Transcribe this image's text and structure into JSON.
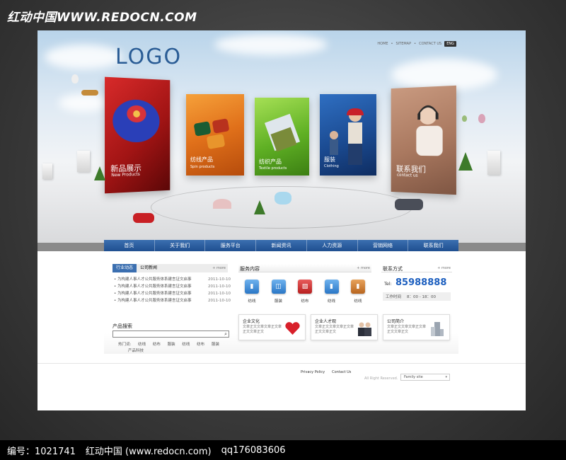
{
  "watermark": {
    "top": "红动中国WWW.REDOCN.COM",
    "bottom_id": "编号：1021741",
    "bottom_site": "红动中国 (www.redocn.com)",
    "bottom_qq": "qq176083606"
  },
  "header": {
    "logo": "LOGO",
    "links": [
      "HOME",
      "SITEMAP",
      "CONTACT US"
    ],
    "separator": "•",
    "lang": "ENG"
  },
  "hero": {
    "panels": [
      {
        "cn": "新品展示",
        "en": "New Products"
      },
      {
        "cn": "纺线产品",
        "en": "Spin products"
      },
      {
        "cn": "纺织产品",
        "en": "Textile products"
      },
      {
        "cn": "服装",
        "en": "Clothing"
      },
      {
        "cn": "联系我们",
        "en": "contact us"
      }
    ]
  },
  "nav": [
    "首页",
    "关于我们",
    "服务平台",
    "新闻资讯",
    "人力资源",
    "营销网络",
    "联系我们"
  ],
  "news": {
    "tab_active": "行业动态",
    "tab_other": "公司新闻",
    "more": "+ more",
    "items": [
      {
        "title": "• 为构建人事人才公共服务体系建言证文启事",
        "date": "2011-10-10"
      },
      {
        "title": "• 为构建人事人才公共服务体系建言证文启事",
        "date": "2011-10-10"
      },
      {
        "title": "• 为构建人事人才公共服务体系建言证文启事",
        "date": "2011-10-10"
      },
      {
        "title": "• 为构建人事人才公共服务体系建言证文启事",
        "date": "2011-10-10"
      }
    ]
  },
  "product_search": {
    "title": "产品搜索",
    "hot_label": "热门词:",
    "hot_words": [
      "纺线",
      "纺布",
      "服装",
      "纺线",
      "纺布",
      "服装",
      "产品科技"
    ]
  },
  "services": {
    "title": "服务内容",
    "more": "+ more",
    "items": [
      "纺线",
      "服装",
      "纺布",
      "纺线",
      "纺线"
    ]
  },
  "contact": {
    "title": "联系方式",
    "more": "+ more",
    "tel_label": "Tel:",
    "tel": "85988888",
    "hours_label": "工作时间",
    "hours": "8：00 - 18：00"
  },
  "cards": [
    {
      "title": "企业文化",
      "body": "文章正文文章文章正文章正文文章正文"
    },
    {
      "title": "企业人才观",
      "body": "文章正文文章文章正文章正文文章正文"
    },
    {
      "title": "公司简介",
      "body": "文章正文文章文章正文章正文文章正文"
    }
  ],
  "footer": {
    "privacy": "Privacy Policy",
    "contact": "Contact Us",
    "rights": "All Right Reserved.",
    "family_site": "Family site"
  }
}
